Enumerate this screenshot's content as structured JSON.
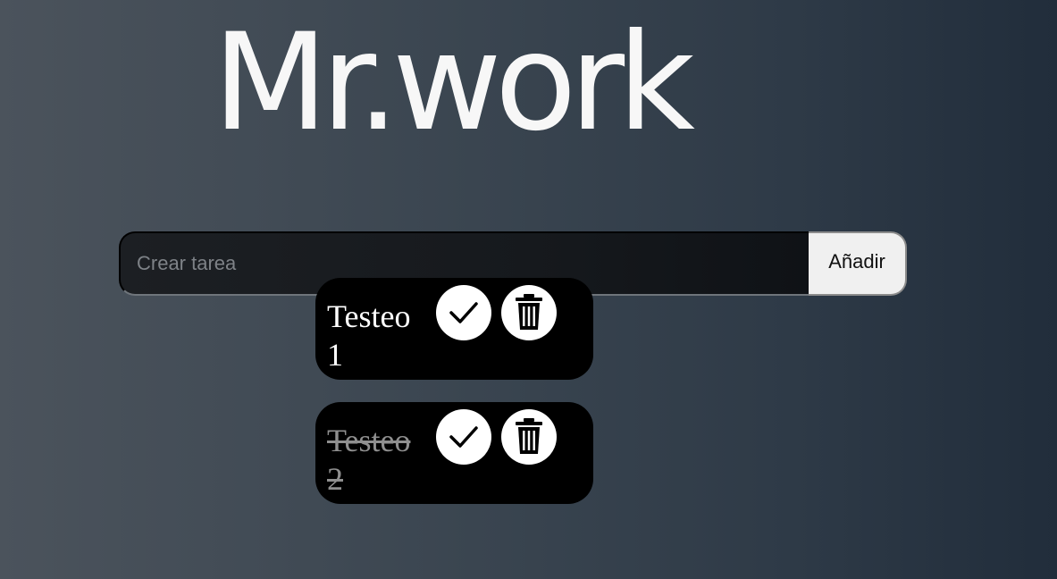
{
  "header": {
    "title": "Mr.work"
  },
  "form": {
    "input_placeholder": "Crear tarea",
    "input_value": "",
    "add_label": "Añadir"
  },
  "tasks": [
    {
      "text": "Testeo 1",
      "completed": false,
      "complete_icon": "check-icon",
      "delete_icon": "trash-icon"
    },
    {
      "text": "Testeo 2",
      "completed": true,
      "complete_icon": "check-icon",
      "delete_icon": "trash-icon"
    }
  ],
  "colors": {
    "title": "#f7f7f7",
    "task_background": "#000000",
    "completed_text": "#8f8f8f",
    "button_background": "#ffffff"
  }
}
